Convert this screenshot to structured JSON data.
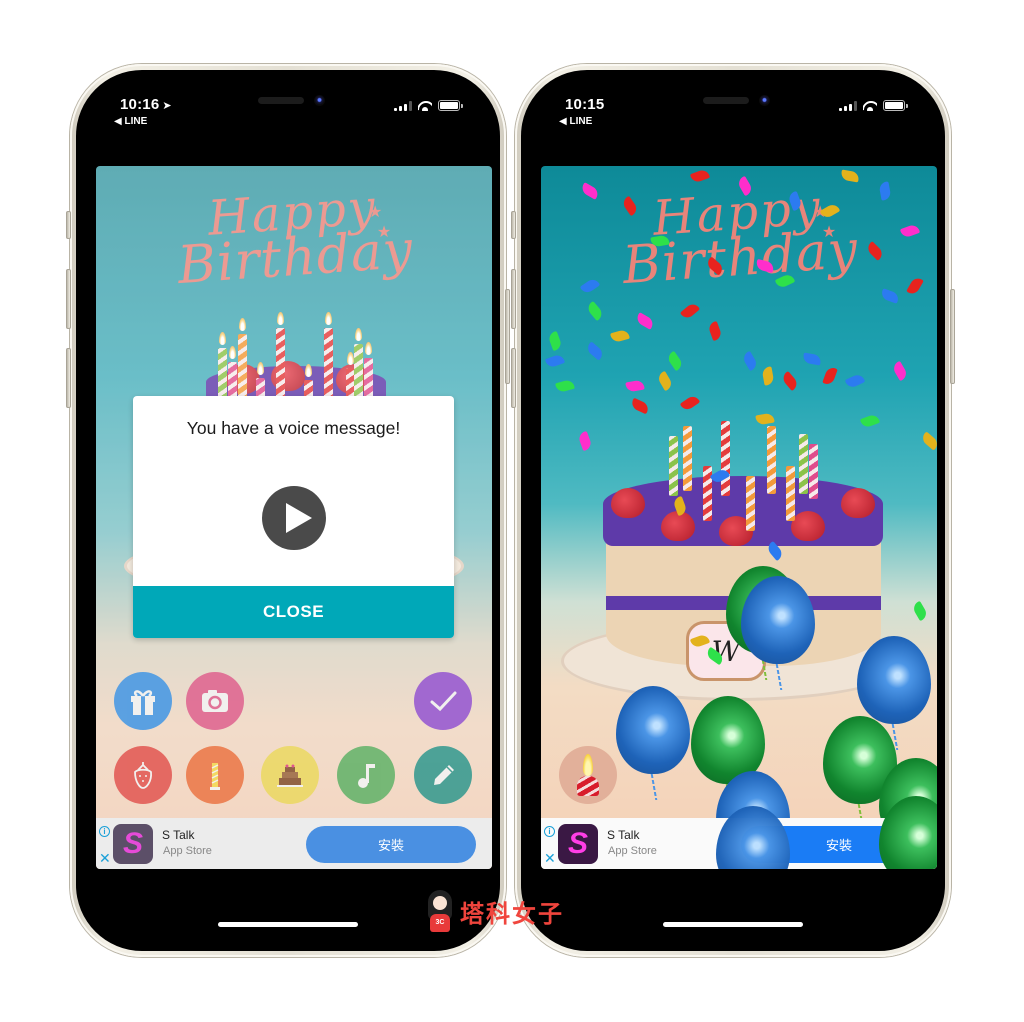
{
  "left_phone": {
    "status_bar": {
      "time": "10:16",
      "location_icon": "location-arrow-icon",
      "back_app": "LINE",
      "icons": [
        "cellular-signal-icon",
        "wifi-icon",
        "battery-icon"
      ]
    },
    "card_title": {
      "line1": "Happy",
      "line2": "Birthday"
    },
    "dialog": {
      "message": "You have a voice message!",
      "play_icon": "play-icon",
      "close_label": "CLOSE"
    },
    "toolbar": {
      "row1": [
        {
          "name": "gift",
          "icon": "gift-icon",
          "color": "#4e9be3"
        },
        {
          "name": "camera",
          "icon": "camera-icon",
          "color": "#e06b93"
        },
        {
          "name": "confirm",
          "icon": "checkmark-icon",
          "color": "#9b5fd1"
        }
      ],
      "row2": [
        {
          "name": "strawberry",
          "icon": "strawberry-icon",
          "color": "#e3605a"
        },
        {
          "name": "candle",
          "icon": "candle-icon",
          "color": "#ec7d4f"
        },
        {
          "name": "cake",
          "icon": "cake-icon",
          "color": "#ecd968"
        },
        {
          "name": "music",
          "icon": "music-note-icon",
          "color": "#6bb56f"
        },
        {
          "name": "edit",
          "icon": "pencil-icon",
          "color": "#3f9d92"
        }
      ]
    },
    "ad": {
      "app_name": "S Talk",
      "store": "App Store",
      "install_label": "安裝",
      "icon_letter": "S",
      "info_icon": "i",
      "close_icon": "✕"
    }
  },
  "right_phone": {
    "status_bar": {
      "time": "10:15",
      "back_app": "LINE",
      "icons": [
        "cellular-signal-icon",
        "wifi-icon",
        "battery-icon"
      ]
    },
    "card_title": {
      "line1": "Happy",
      "line2": "Birthday"
    },
    "plaque_text": "W",
    "candle_button_icon": "candle-icon",
    "ad": {
      "app_name": "S Talk",
      "store": "App Store",
      "install_label": "安裝",
      "icon_letter": "S",
      "info_icon": "i",
      "close_icon": "✕"
    }
  },
  "watermark": {
    "text": "塔科女子",
    "badge": "3C"
  },
  "colors": {
    "dialog_close": "#00a8b8",
    "install_button_left": "#4a90e2",
    "install_button_right": "#1a7cf5",
    "title_pink": "#e8847a",
    "watermark_red": "#f0453d"
  }
}
